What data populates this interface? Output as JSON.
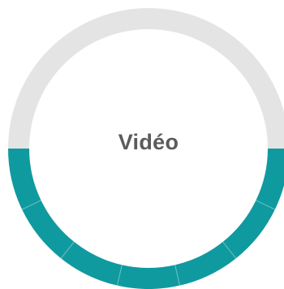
{
  "chart_data": {
    "type": "donut",
    "center_label": "Vidéo",
    "total_segments": 14,
    "filled_segments": 7,
    "progress": 0.5,
    "fill_color": "#0f9aa0",
    "track_color": "#e4e4e4",
    "segment_gap_color": "#ffffff"
  }
}
